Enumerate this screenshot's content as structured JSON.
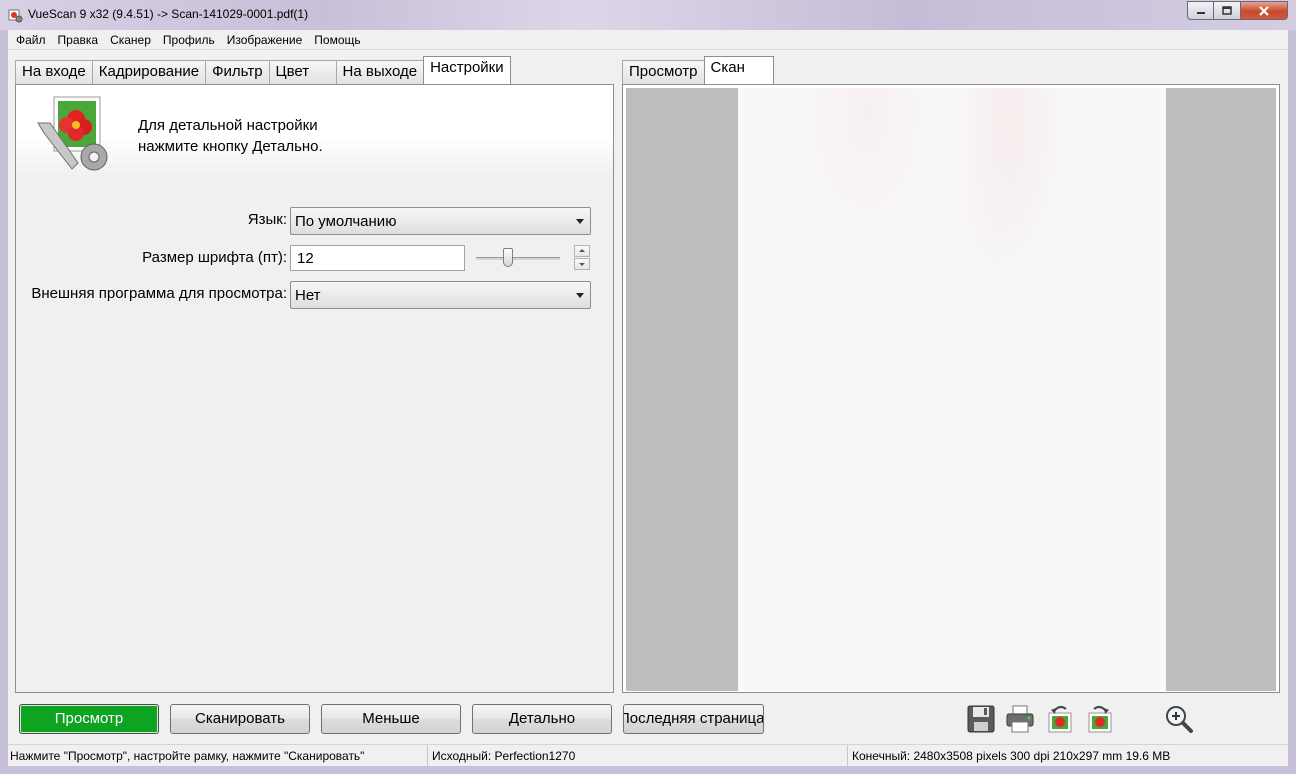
{
  "window": {
    "title": "VueScan 9 x32 (9.4.51) -> Scan-141029-0001.pdf(1)"
  },
  "menu": [
    "Файл",
    "Правка",
    "Сканер",
    "Профиль",
    "Изображение",
    "Помощь"
  ],
  "left_tabs": [
    {
      "label": "На входе",
      "active": false
    },
    {
      "label": "Кадрирование",
      "active": false
    },
    {
      "label": "Фильтр",
      "active": false
    },
    {
      "label": "Цвет",
      "active": false
    },
    {
      "label": "На выходе",
      "active": false
    },
    {
      "label": "Настройки",
      "active": true
    }
  ],
  "right_tabs": [
    {
      "label": "Просмотр",
      "active": false
    },
    {
      "label": "Скан",
      "active": true
    }
  ],
  "banner": {
    "line1": "Для детальной настройки",
    "line2": "нажмите кнопку Детально."
  },
  "settings": {
    "language": {
      "label": "Язык:",
      "value": "По умолчанию"
    },
    "font_size": {
      "label": "Размер шрифта (пт):",
      "value": "12"
    },
    "viewer": {
      "label": "Внешняя программа для просмотра:",
      "value": "Нет"
    }
  },
  "buttons": {
    "preview": "Просмотр",
    "scan": "Сканировать",
    "less": "Меньше",
    "more": "Детально",
    "last_page": "Последняя страница"
  },
  "toolbar_icons": [
    "save-icon",
    "print-icon",
    "rotate-left-icon",
    "rotate-right-icon",
    "zoom-in-icon"
  ],
  "status": {
    "hint": "Нажмите \"Просмотр\", настройте рамку, нажмите \"Сканировать\"",
    "source": "Исходный: Perfection1270",
    "output": "Конечный: 2480x3508 pixels 300 dpi 210x297 mm 19.6 MB"
  },
  "colors": {
    "preview_button": "#0ea421",
    "scan_background": "#bdbdbd",
    "close_button": "#c74a2f"
  }
}
